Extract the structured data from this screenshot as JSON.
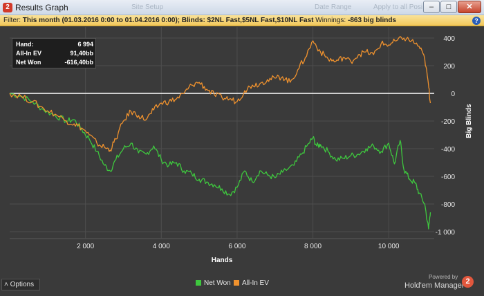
{
  "window": {
    "title": "Results Graph",
    "app_icon_letter": "2",
    "background_tabs": [
      "Site Setup",
      "Date Range",
      "Apply to all Posi"
    ]
  },
  "filter": {
    "prefix": "Filter:",
    "text": "This month (01.03.2016 0:00 to 01.04.2016 0:00); Blinds: $2NL Fast,$5NL Fast,$10NL Fast",
    "winnings_label": "Winnings:",
    "winnings_value": "-863 big blinds",
    "help": "?"
  },
  "stats": {
    "hand_label": "Hand:",
    "hand_value": "6 994",
    "allin_label": "All-In EV",
    "allin_value": "91,40bb",
    "netwon_label": "Net Won",
    "netwon_value": "-616,40bb"
  },
  "legend": {
    "net_won": "Net Won",
    "allin_ev": "All-In EV",
    "net_won_color": "#3ec83e",
    "allin_ev_color": "#f0922e"
  },
  "footer": {
    "options": "Options",
    "powered": "Powered by",
    "brand": "Hold'em Manager",
    "brand_logo": "2"
  },
  "chart_data": {
    "type": "line",
    "xlabel": "Hands",
    "ylabel": "Big Blinds",
    "xlim": [
      0,
      11200
    ],
    "ylim": [
      -1050,
      480
    ],
    "x_ticks": [
      2000,
      4000,
      6000,
      8000,
      10000
    ],
    "x_tick_labels": [
      "2 000",
      "4 000",
      "6 000",
      "8 000",
      "10 000"
    ],
    "y_ticks": [
      400,
      200,
      0,
      -200,
      -400,
      -600,
      -800,
      -1000
    ],
    "y_tick_labels": [
      "400",
      "200",
      "0",
      "-200",
      "-400",
      "-600",
      "-800",
      "-1 000"
    ],
    "grid": true,
    "zero_line": true,
    "series": [
      {
        "name": "Net Won",
        "color": "#3ec83e",
        "points": [
          [
            0,
            0
          ],
          [
            300,
            -20
          ],
          [
            600,
            -60
          ],
          [
            900,
            -120
          ],
          [
            1200,
            -160
          ],
          [
            1500,
            -200
          ],
          [
            1700,
            -190
          ],
          [
            1900,
            -260
          ],
          [
            2100,
            -330
          ],
          [
            2300,
            -420
          ],
          [
            2500,
            -520
          ],
          [
            2650,
            -560
          ],
          [
            2800,
            -480
          ],
          [
            3000,
            -400
          ],
          [
            3200,
            -360
          ],
          [
            3400,
            -430
          ],
          [
            3600,
            -440
          ],
          [
            3800,
            -380
          ],
          [
            4000,
            -480
          ],
          [
            4200,
            -520
          ],
          [
            4400,
            -500
          ],
          [
            4600,
            -560
          ],
          [
            4800,
            -580
          ],
          [
            5000,
            -620
          ],
          [
            5200,
            -640
          ],
          [
            5400,
            -660
          ],
          [
            5600,
            -690
          ],
          [
            5800,
            -730
          ],
          [
            6000,
            -680
          ],
          [
            6200,
            -560
          ],
          [
            6400,
            -640
          ],
          [
            6600,
            -560
          ],
          [
            6800,
            -590
          ],
          [
            7000,
            -610
          ],
          [
            7200,
            -570
          ],
          [
            7500,
            -520
          ],
          [
            7700,
            -440
          ],
          [
            7900,
            -360
          ],
          [
            8000,
            -320
          ],
          [
            8100,
            -380
          ],
          [
            8200,
            -370
          ],
          [
            8400,
            -420
          ],
          [
            8600,
            -480
          ],
          [
            8800,
            -470
          ],
          [
            9000,
            -450
          ],
          [
            9200,
            -440
          ],
          [
            9400,
            -400
          ],
          [
            9600,
            -380
          ],
          [
            9800,
            -420
          ],
          [
            10000,
            -360
          ],
          [
            10150,
            -510
          ],
          [
            10300,
            -340
          ],
          [
            10400,
            -550
          ],
          [
            10550,
            -620
          ],
          [
            10700,
            -650
          ],
          [
            10800,
            -720
          ],
          [
            10950,
            -800
          ],
          [
            11050,
            -980
          ],
          [
            11100,
            -860
          ]
        ]
      },
      {
        "name": "All-In EV",
        "color": "#f0922e",
        "points": [
          [
            0,
            0
          ],
          [
            300,
            -20
          ],
          [
            600,
            -60
          ],
          [
            900,
            -110
          ],
          [
            1200,
            -150
          ],
          [
            1500,
            -200
          ],
          [
            1700,
            -220
          ],
          [
            1900,
            -250
          ],
          [
            2100,
            -300
          ],
          [
            2300,
            -360
          ],
          [
            2500,
            -390
          ],
          [
            2650,
            -410
          ],
          [
            2800,
            -330
          ],
          [
            3000,
            -200
          ],
          [
            3200,
            -130
          ],
          [
            3400,
            -160
          ],
          [
            3600,
            -190
          ],
          [
            3800,
            -120
          ],
          [
            4000,
            -70
          ],
          [
            4200,
            -60
          ],
          [
            4400,
            -40
          ],
          [
            4600,
            0
          ],
          [
            4800,
            60
          ],
          [
            5000,
            80
          ],
          [
            5200,
            30
          ],
          [
            5400,
            -10
          ],
          [
            5600,
            -30
          ],
          [
            5800,
            -40
          ],
          [
            6000,
            -60
          ],
          [
            6200,
            20
          ],
          [
            6400,
            60
          ],
          [
            6600,
            70
          ],
          [
            6800,
            100
          ],
          [
            7000,
            110
          ],
          [
            7200,
            120
          ],
          [
            7400,
            80
          ],
          [
            7600,
            170
          ],
          [
            7800,
            260
          ],
          [
            8000,
            380
          ],
          [
            8200,
            300
          ],
          [
            8400,
            250
          ],
          [
            8600,
            230
          ],
          [
            8800,
            260
          ],
          [
            9000,
            230
          ],
          [
            9200,
            280
          ],
          [
            9400,
            300
          ],
          [
            9600,
            280
          ],
          [
            9800,
            360
          ],
          [
            10000,
            350
          ],
          [
            10200,
            380
          ],
          [
            10400,
            400
          ],
          [
            10600,
            380
          ],
          [
            10800,
            340
          ],
          [
            10950,
            250
          ],
          [
            11050,
            60
          ],
          [
            11100,
            -70
          ]
        ]
      }
    ]
  }
}
